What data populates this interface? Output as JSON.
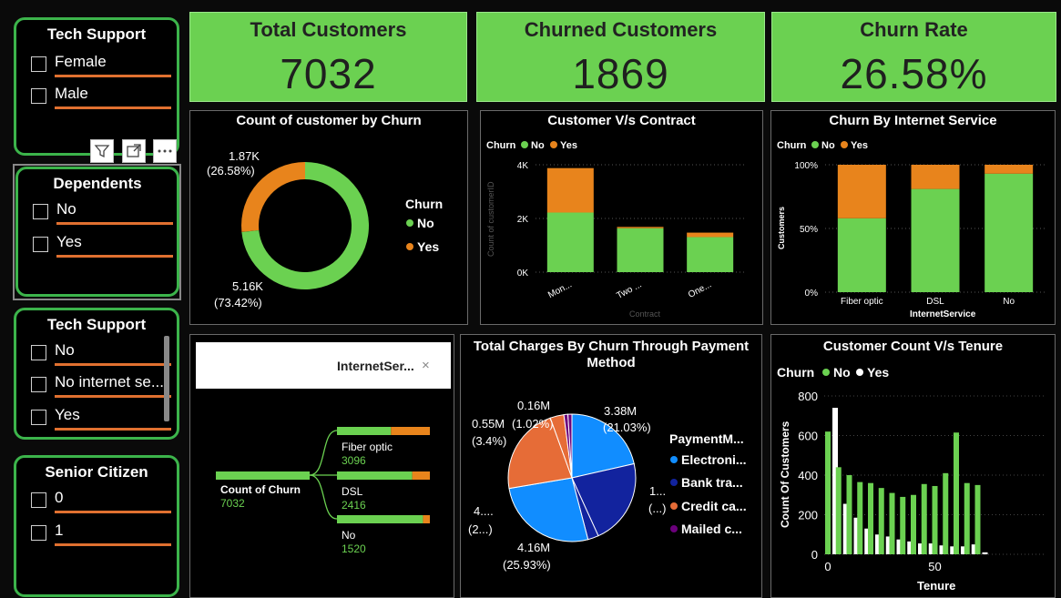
{
  "colors": {
    "green": "#6bd151",
    "orange": "#e8841c",
    "white": "#ffffff",
    "blue": "#118dff",
    "navy": "#12239e",
    "coral": "#e66c37",
    "purple": "#6b007b"
  },
  "slicers": [
    {
      "title": "Tech Support",
      "items": [
        "Female",
        "Male"
      ]
    },
    {
      "title": "Dependents",
      "items": [
        "No",
        "Yes"
      ]
    },
    {
      "title": "Tech Support",
      "items": [
        "No",
        "No internet se...",
        "Yes"
      ]
    },
    {
      "title": "Senior Citizen",
      "items": [
        "0",
        "1"
      ]
    }
  ],
  "kpis": [
    {
      "title": "Total Customers",
      "value": "7032"
    },
    {
      "title": "Churned Customers",
      "value": "1869"
    },
    {
      "title": "Churn Rate",
      "value": "26.58%"
    }
  ],
  "visual_icons": [
    "filter-icon",
    "focus-mode-icon",
    "more-options-icon"
  ],
  "donut": {
    "title": "Count of customer by Churn",
    "legend_title": "Churn",
    "label_yes_value": "1.87K",
    "label_yes_pct": "(26.58%)",
    "label_no_value": "5.16K",
    "label_no_pct": "(73.42%)"
  },
  "contract": {
    "title": "Customer V/s Contract",
    "legend_title": "Churn",
    "ylabel": "Count of customerID",
    "xlabel": "Contract",
    "yticks": [
      "4K",
      "2K",
      "0K"
    ]
  },
  "internet": {
    "title": "Churn By Internet Service",
    "legend_title": "Churn",
    "ylabel": "Customers",
    "xlabel": "InternetService",
    "yticks": [
      "100%",
      "50%",
      "0%"
    ]
  },
  "decomp": {
    "header_label": "InternetSer...",
    "close_glyph": "×",
    "root_label": "Count of Churn",
    "root_value": "7032"
  },
  "pie": {
    "title_line1": "Total Charges By Churn Through Payment",
    "title_line2": "Method",
    "legend_title": "PaymentM...",
    "labels": {
      "electronic_value": "3.38M",
      "electronic_pct": "(21.03%)",
      "bank_value": "1...",
      "bank_pct": "(...)",
      "mailed_value": "0.16M",
      "mailed_pct": "(1.02%)",
      "small_value": "0.55M",
      "small_pct": "(3.4%)",
      "credit_value": "4....",
      "credit_pct": "(2...)",
      "navy_value": "4.16M",
      "navy_pct": "(25.93%)"
    }
  },
  "tenure": {
    "title": "Customer Count V/s Tenure",
    "legend_title": "Churn",
    "ylabel": "Count Of Customers",
    "xlabel": "Tenure",
    "yticks": [
      "800",
      "600",
      "400",
      "200",
      "0"
    ],
    "xticks": [
      "0",
      "50"
    ]
  },
  "chart_data": [
    {
      "type": "pie",
      "title": "Count of customer by Churn",
      "categories": [
        "No",
        "Yes"
      ],
      "values": [
        5163,
        1869
      ],
      "legend_title": "Churn",
      "legend_position": "right"
    },
    {
      "type": "bar",
      "title": "Customer V/s Contract",
      "categories": [
        "Mon...",
        "Two ...",
        "One..."
      ],
      "series": [
        {
          "name": "No",
          "values": [
            2220,
            1637,
            1306
          ]
        },
        {
          "name": "Yes",
          "values": [
            1655,
            48,
            166
          ]
        }
      ],
      "xlabel": "Contract",
      "ylabel": "Count of customerID",
      "ylim": [
        0,
        4000
      ],
      "legend_title": "Churn",
      "legend_position": "top-left"
    },
    {
      "type": "bar",
      "title": "Churn By Internet Service",
      "categories": [
        "Fiber optic",
        "DSL",
        "No"
      ],
      "series": [
        {
          "name": "No",
          "values": [
            58,
            81,
            93
          ]
        },
        {
          "name": "Yes",
          "values": [
            42,
            19,
            7
          ]
        }
      ],
      "xlabel": "InternetService",
      "ylabel": "Customers",
      "ylim": [
        0,
        100
      ],
      "legend_title": "Churn",
      "legend_position": "top-left"
    },
    {
      "type": "bar",
      "title": "InternetSer...",
      "root": {
        "label": "Count of Churn",
        "value": 7032
      },
      "categories": [
        "Fiber optic",
        "DSL",
        "No"
      ],
      "values": [
        3096,
        2416,
        1520
      ],
      "series": [
        {
          "name": "No",
          "values": [
            1799,
            1957,
            1407
          ]
        },
        {
          "name": "Yes",
          "values": [
            1297,
            459,
            113
          ]
        }
      ]
    },
    {
      "type": "pie",
      "title": "Total Charges By Churn Through Payment Method",
      "legend_title": "PaymentM...",
      "legend": [
        "Electroni...",
        "Bank tra...",
        "Credit ca...",
        "Mailed c..."
      ],
      "slices": [
        {
          "payment": "Electronic",
          "churn": "No",
          "value": 3.38,
          "pct": 21.03
        },
        {
          "payment": "Bank transfer",
          "churn": "No",
          "value": 3.43,
          "pct": 21.3
        },
        {
          "payment": "Bank transfer",
          "churn": "Yes",
          "value": 0.43,
          "pct": 2.7
        },
        {
          "payment": "Electronic",
          "churn": "Yes",
          "value": 4.16,
          "pct": 25.93
        },
        {
          "payment": "Credit card",
          "churn": "No",
          "value": 3.49,
          "pct": 21.7
        },
        {
          "payment": "Credit card",
          "churn": "Yes",
          "value": 0.55,
          "pct": 3.4
        },
        {
          "payment": "Mailed check",
          "churn": "No",
          "value": 0.16,
          "pct": 1.02
        },
        {
          "payment": "Mailed check",
          "churn": "Yes",
          "value": 0.16,
          "pct": 1.02
        }
      ],
      "legend_position": "right"
    },
    {
      "type": "bar",
      "title": "Customer Count V/s Tenure",
      "x": [
        0,
        5,
        10,
        15,
        20,
        25,
        30,
        35,
        40,
        45,
        50,
        55,
        60,
        65,
        70
      ],
      "series": [
        {
          "name": "No",
          "values": [
            620,
            440,
            400,
            365,
            360,
            335,
            310,
            290,
            300,
            355,
            345,
            410,
            615,
            360,
            350
          ]
        },
        {
          "name": "Yes",
          "values": [
            740,
            255,
            185,
            130,
            100,
            90,
            75,
            65,
            55,
            55,
            45,
            40,
            40,
            50,
            10
          ]
        }
      ],
      "xlabel": "Tenure",
      "ylabel": "Count Of Customers",
      "ylim": [
        0,
        800
      ],
      "legend_title": "Churn",
      "legend_position": "top-left"
    }
  ]
}
